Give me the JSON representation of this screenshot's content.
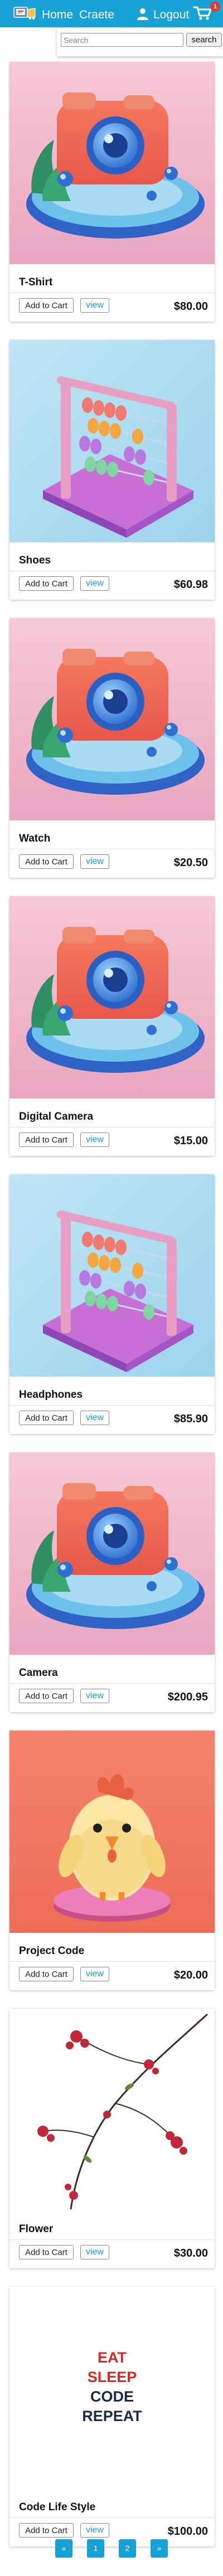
{
  "navbar": {
    "logo": "logo",
    "home_label": "Home",
    "create_label": "Craete",
    "user_icon": "user-icon",
    "logout_label": "Logout",
    "cart_icon": "cart-icon",
    "cart_count": "1",
    "color": "#17a2d6"
  },
  "search": {
    "placeholder": "Search",
    "button_label": "search"
  },
  "products": [
    {
      "title": "T-Shirt",
      "price": "$80.00",
      "image": "camera-illustration",
      "add_label": "Add to Cart",
      "view_label": "view"
    },
    {
      "title": "Shoes",
      "price": "$60.98",
      "image": "abacus-illustration",
      "add_label": "Add to Cart",
      "view_label": "view"
    },
    {
      "title": "Watch",
      "price": "$20.50",
      "image": "camera-illustration",
      "add_label": "Add to Cart",
      "view_label": "view"
    },
    {
      "title": "Digital Camera",
      "price": "$15.00",
      "image": "camera-illustration",
      "add_label": "Add to Cart",
      "view_label": "view"
    },
    {
      "title": "Headphones",
      "price": "$85.90",
      "image": "abacus-illustration",
      "add_label": "Add to Cart",
      "view_label": "view"
    },
    {
      "title": "Camera",
      "price": "$200.95",
      "image": "camera-illustration",
      "add_label": "Add to Cart",
      "view_label": "view"
    },
    {
      "title": "Project Code",
      "price": "$20.00",
      "image": "chick-illustration",
      "add_label": "Add to Cart",
      "view_label": "view"
    },
    {
      "title": "Flower",
      "price": "$30.00",
      "image": "flower-branch-illustration",
      "add_label": "Add to Cart",
      "view_label": "view"
    },
    {
      "title": "Code Life Style",
      "price": "$100.00",
      "image": "eat-sleep-code-repeat-poster",
      "add_label": "Add to Cart",
      "view_label": "view"
    }
  ],
  "poster": {
    "line1": "EAT",
    "line2": "SLEEP",
    "line3": "CODE",
    "line4": "REPEAT"
  },
  "pagination": {
    "prev_label": "«",
    "pages": [
      "1",
      "2"
    ],
    "next_label": "»"
  }
}
